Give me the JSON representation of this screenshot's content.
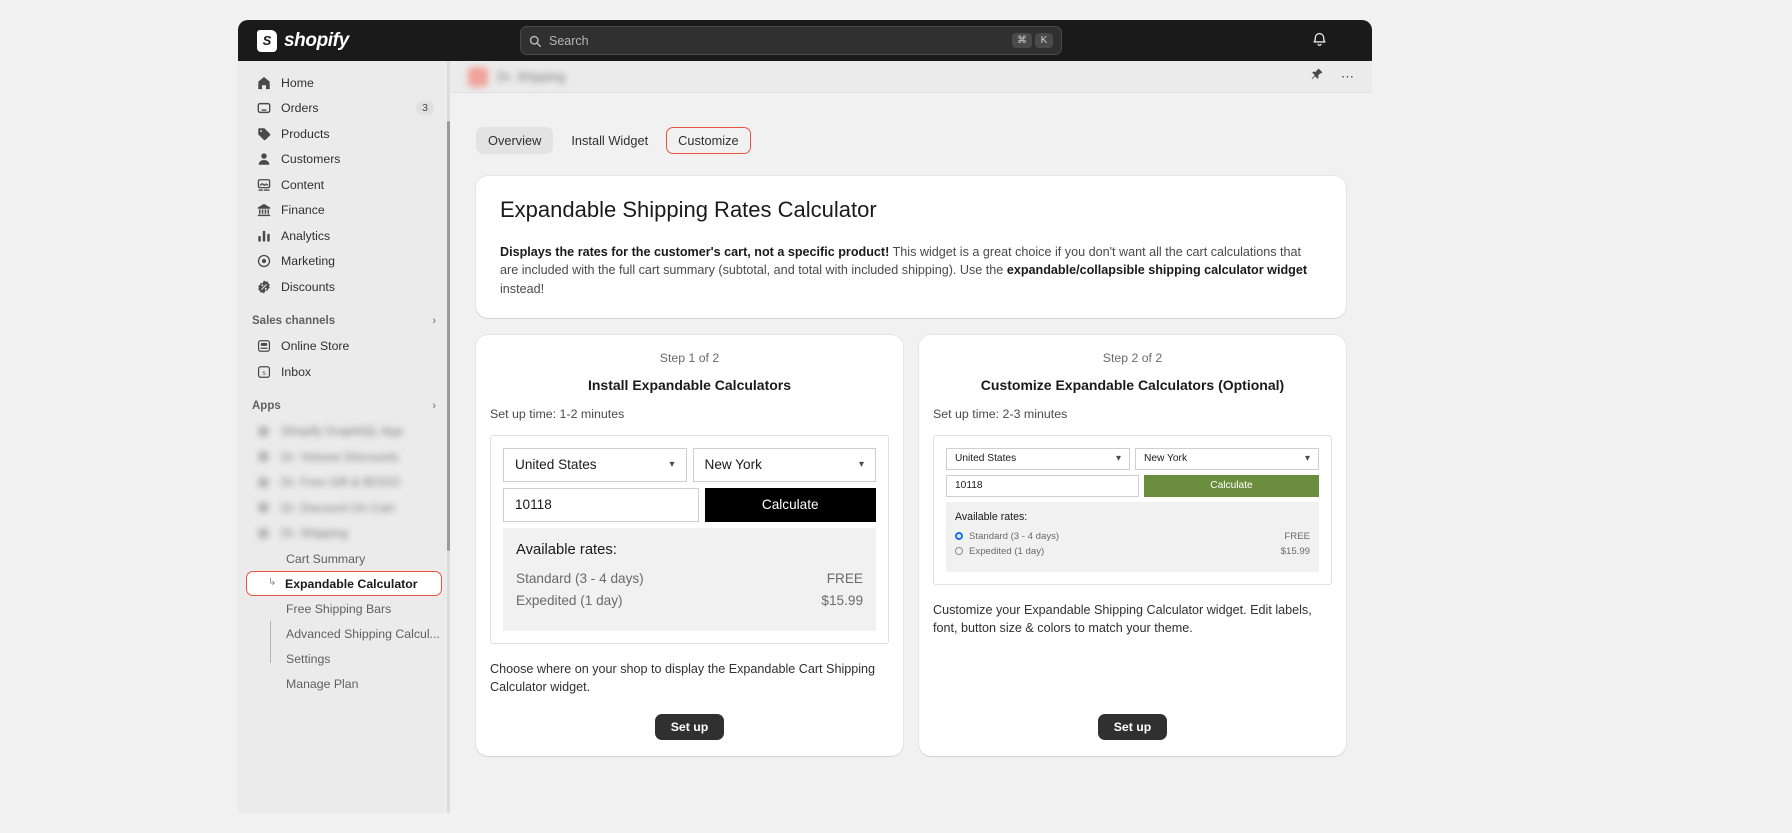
{
  "topbar": {
    "brand": "shopify",
    "logo_mark": "S",
    "search_placeholder": "Search",
    "search_icon": "search-icon",
    "shortcut_cmd": "⌘",
    "shortcut_key": "K",
    "notification_icon": "bell-icon"
  },
  "sidebar": {
    "main_items": [
      {
        "icon": "home-icon",
        "label": "Home",
        "badge": ""
      },
      {
        "icon": "orders-icon",
        "label": "Orders",
        "badge": "3"
      },
      {
        "icon": "products-icon",
        "label": "Products",
        "badge": ""
      },
      {
        "icon": "customers-icon",
        "label": "Customers",
        "badge": ""
      },
      {
        "icon": "content-icon",
        "label": "Content",
        "badge": ""
      },
      {
        "icon": "finance-icon",
        "label": "Finance",
        "badge": ""
      },
      {
        "icon": "analytics-icon",
        "label": "Analytics",
        "badge": ""
      },
      {
        "icon": "marketing-icon",
        "label": "Marketing",
        "badge": ""
      },
      {
        "icon": "discounts-icon",
        "label": "Discounts",
        "badge": ""
      }
    ],
    "sales_channels": {
      "heading": "Sales channels",
      "items": [
        {
          "icon": "online-store-icon",
          "label": "Online Store"
        },
        {
          "icon": "inbox-icon",
          "label": "Inbox"
        }
      ]
    },
    "apps": {
      "heading": "Apps",
      "blurred_items": [
        "Shopify GraphiQL App",
        "Dr. Volume Discounts",
        "Dr. Free Gift & BOGO",
        "Dr. Discount On Cart",
        "Dr. Shipping"
      ],
      "sub_items": [
        {
          "label": "Cart Summary",
          "active": false
        },
        {
          "label": "Expandable Calculator",
          "active": true
        },
        {
          "label": "Free Shipping Bars",
          "active": false
        },
        {
          "label": "Advanced Shipping Calcul...",
          "active": false
        },
        {
          "label": "Settings",
          "active": false
        },
        {
          "label": "Manage Plan",
          "active": false
        }
      ]
    }
  },
  "app_header": {
    "app_name": "Dr. Shipping",
    "pin_icon": "pin-icon",
    "more_icon": "ellipsis-icon"
  },
  "tabs": [
    {
      "label": "Overview",
      "selected": true,
      "highlight": false
    },
    {
      "label": "Install Widget",
      "selected": false,
      "highlight": false
    },
    {
      "label": "Customize",
      "selected": false,
      "highlight": true
    }
  ],
  "intro": {
    "title": "Expandable Shipping Rates Calculator",
    "bold_lead": "Displays the rates for the customer's cart, not a specific product!",
    "body_1": " This widget is a great choice if you don't want all the cart calculations that are included with the full cart summary (subtotal, and total with included shipping). Use the ",
    "bold_mid": "expandable/collapsible shipping calculator widget",
    "body_2": " instead!"
  },
  "widget_preview": {
    "country": "United States",
    "state": "New York",
    "zip": "10118",
    "calculate_label": "Calculate",
    "rates_title": "Available rates:",
    "rates": [
      {
        "name": "Standard (3 - 4 days)",
        "price": "FREE",
        "selected": true
      },
      {
        "name": "Expedited (1 day)",
        "price": "$15.99",
        "selected": false
      }
    ]
  },
  "step_one": {
    "step_label": "Step 1 of 2",
    "title": "Install Expandable Calculators",
    "setup_time": "Set up time: 1-2 minutes",
    "note": "Choose where on your shop to display the Expandable Cart Shipping Calculator widget.",
    "button": "Set up",
    "button_color": "#303030"
  },
  "step_two": {
    "step_label": "Step 2 of 2",
    "title": "Customize Expandable Calculators (Optional)",
    "setup_time": "Set up time: 2-3 minutes",
    "note": "Customize your Expandable Shipping Calculator widget. Edit labels, font, button size & colors to match your theme.",
    "button": "Set up",
    "calculate_button_color": "#6b8e3e"
  },
  "colors": {
    "accent_highlight": "#e8553f",
    "topbar_bg": "#1a1a1a",
    "sidebar_bg": "#ebebeb",
    "canvas_bg": "#f1f1f1",
    "calculate_dark": "#000000",
    "calculate_green": "#6b8e3e",
    "radio_blue": "#1a73e8"
  }
}
